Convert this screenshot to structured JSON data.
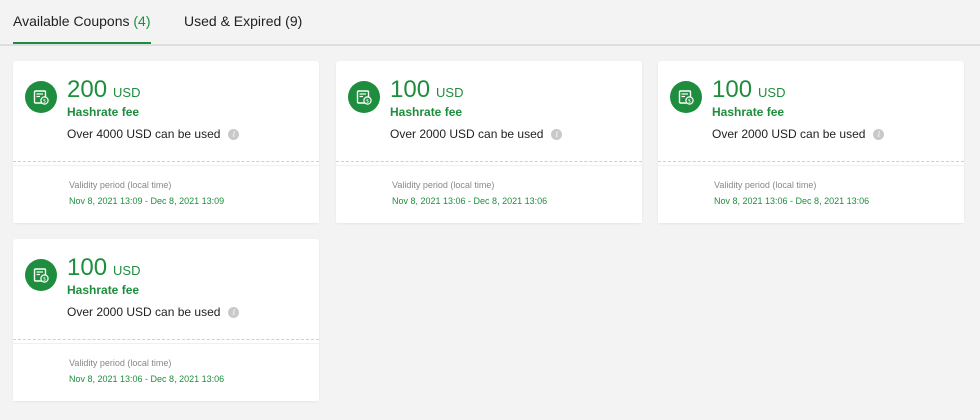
{
  "tabs": {
    "available_label": "Available Coupons",
    "available_count": "(4)",
    "used_label": "Used & Expired (9)"
  },
  "colors": {
    "accent": "#1e8e3e",
    "background": "#f3f3f3",
    "card": "#ffffff"
  },
  "coupons": [
    {
      "amount": "200",
      "currency": "USD",
      "fee_type": "Hashrate fee",
      "condition": "Over 4000 USD can be used",
      "validity_label": "Validity period (local time)",
      "validity_range": "Nov 8, 2021 13:09 - Dec 8, 2021 13:09",
      "icon": "coupon-icon"
    },
    {
      "amount": "100",
      "currency": "USD",
      "fee_type": "Hashrate fee",
      "condition": "Over 2000 USD can be used",
      "validity_label": "Validity period (local time)",
      "validity_range": "Nov 8, 2021 13:06 - Dec 8, 2021 13:06",
      "icon": "coupon-icon"
    },
    {
      "amount": "100",
      "currency": "USD",
      "fee_type": "Hashrate fee",
      "condition": "Over 2000 USD can be used",
      "validity_label": "Validity period (local time)",
      "validity_range": "Nov 8, 2021 13:06 - Dec 8, 2021 13:06",
      "icon": "coupon-icon"
    },
    {
      "amount": "100",
      "currency": "USD",
      "fee_type": "Hashrate fee",
      "condition": "Over 2000 USD can be used",
      "validity_label": "Validity period (local time)",
      "validity_range": "Nov 8, 2021 13:06 - Dec 8, 2021 13:06",
      "icon": "coupon-icon"
    }
  ]
}
